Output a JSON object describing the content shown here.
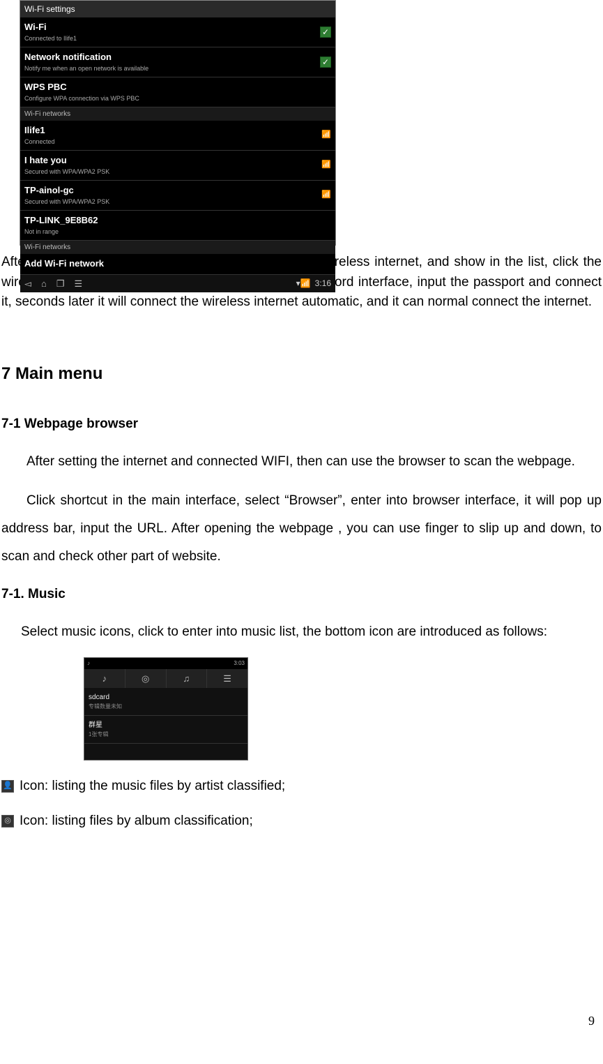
{
  "wifi": {
    "header": "Wi-Fi settings",
    "wifi_label": "Wi-Fi",
    "wifi_sub": "Connected to Ilife1",
    "notif_label": "Network notification",
    "notif_sub": "Notify me when an open network is available",
    "wps_label": "WPS PBC",
    "wps_sub": "Configure WPA connection via WPS PBC",
    "networks_hdr": "Wi-Fi networks",
    "net1": "Ilife1",
    "net1_sub": "Connected",
    "net2": "I hate you",
    "net2_sub": "Secured with WPA/WPA2 PSK",
    "net3": "TP-ainol-gc",
    "net3_sub": "Secured with WPA/WPA2 PSK",
    "net4": "TP-LINK_9E8B62",
    "net4_sub": "Not in range",
    "networks_hdr2": "Wi-Fi networks",
    "add": "Add Wi-Fi network",
    "time": "3:16"
  },
  "para_wifi": "After WIFI opened, it will automatic searching for the wireless internet, and show in the list, click the wireless internet(for example:Iife1), enter into the password interface, input the passport and connect it, seconds later it will connect the wireless internet automatic, and it can normal connect the internet.",
  "section7": "7 Main menu",
  "s71_title": "7-1 Webpage browser",
  "s71_p1": "After setting the internet and connected WIFI, then can use the browser to scan the webpage.",
  "s71_p2": "Click shortcut in the main interface, select “Browser”, enter into browser interface, it will pop up address bar, input the URL. After opening the webpage , you can use finger to slip up and down, to scan and check other part of website.",
  "s72_title": "7-1. Music",
  "s72_p1": "Select music icons, click to enter into music list, the bottom icon are introduced as follows:",
  "icon_artist_text": "Icon: listing the music files by artist classified;",
  "icon_album_text": "Icon: listing files by album classification;",
  "music": {
    "tab_artist": "♪",
    "tab_album": "◎",
    "tab_song": "♫",
    "tab_list": "☰",
    "row1_t": "sdcard",
    "row1_s": "专辑数量未知",
    "row2_t": "群星",
    "row2_s": "1张专辑",
    "time": "3:03"
  },
  "page_number": "9"
}
